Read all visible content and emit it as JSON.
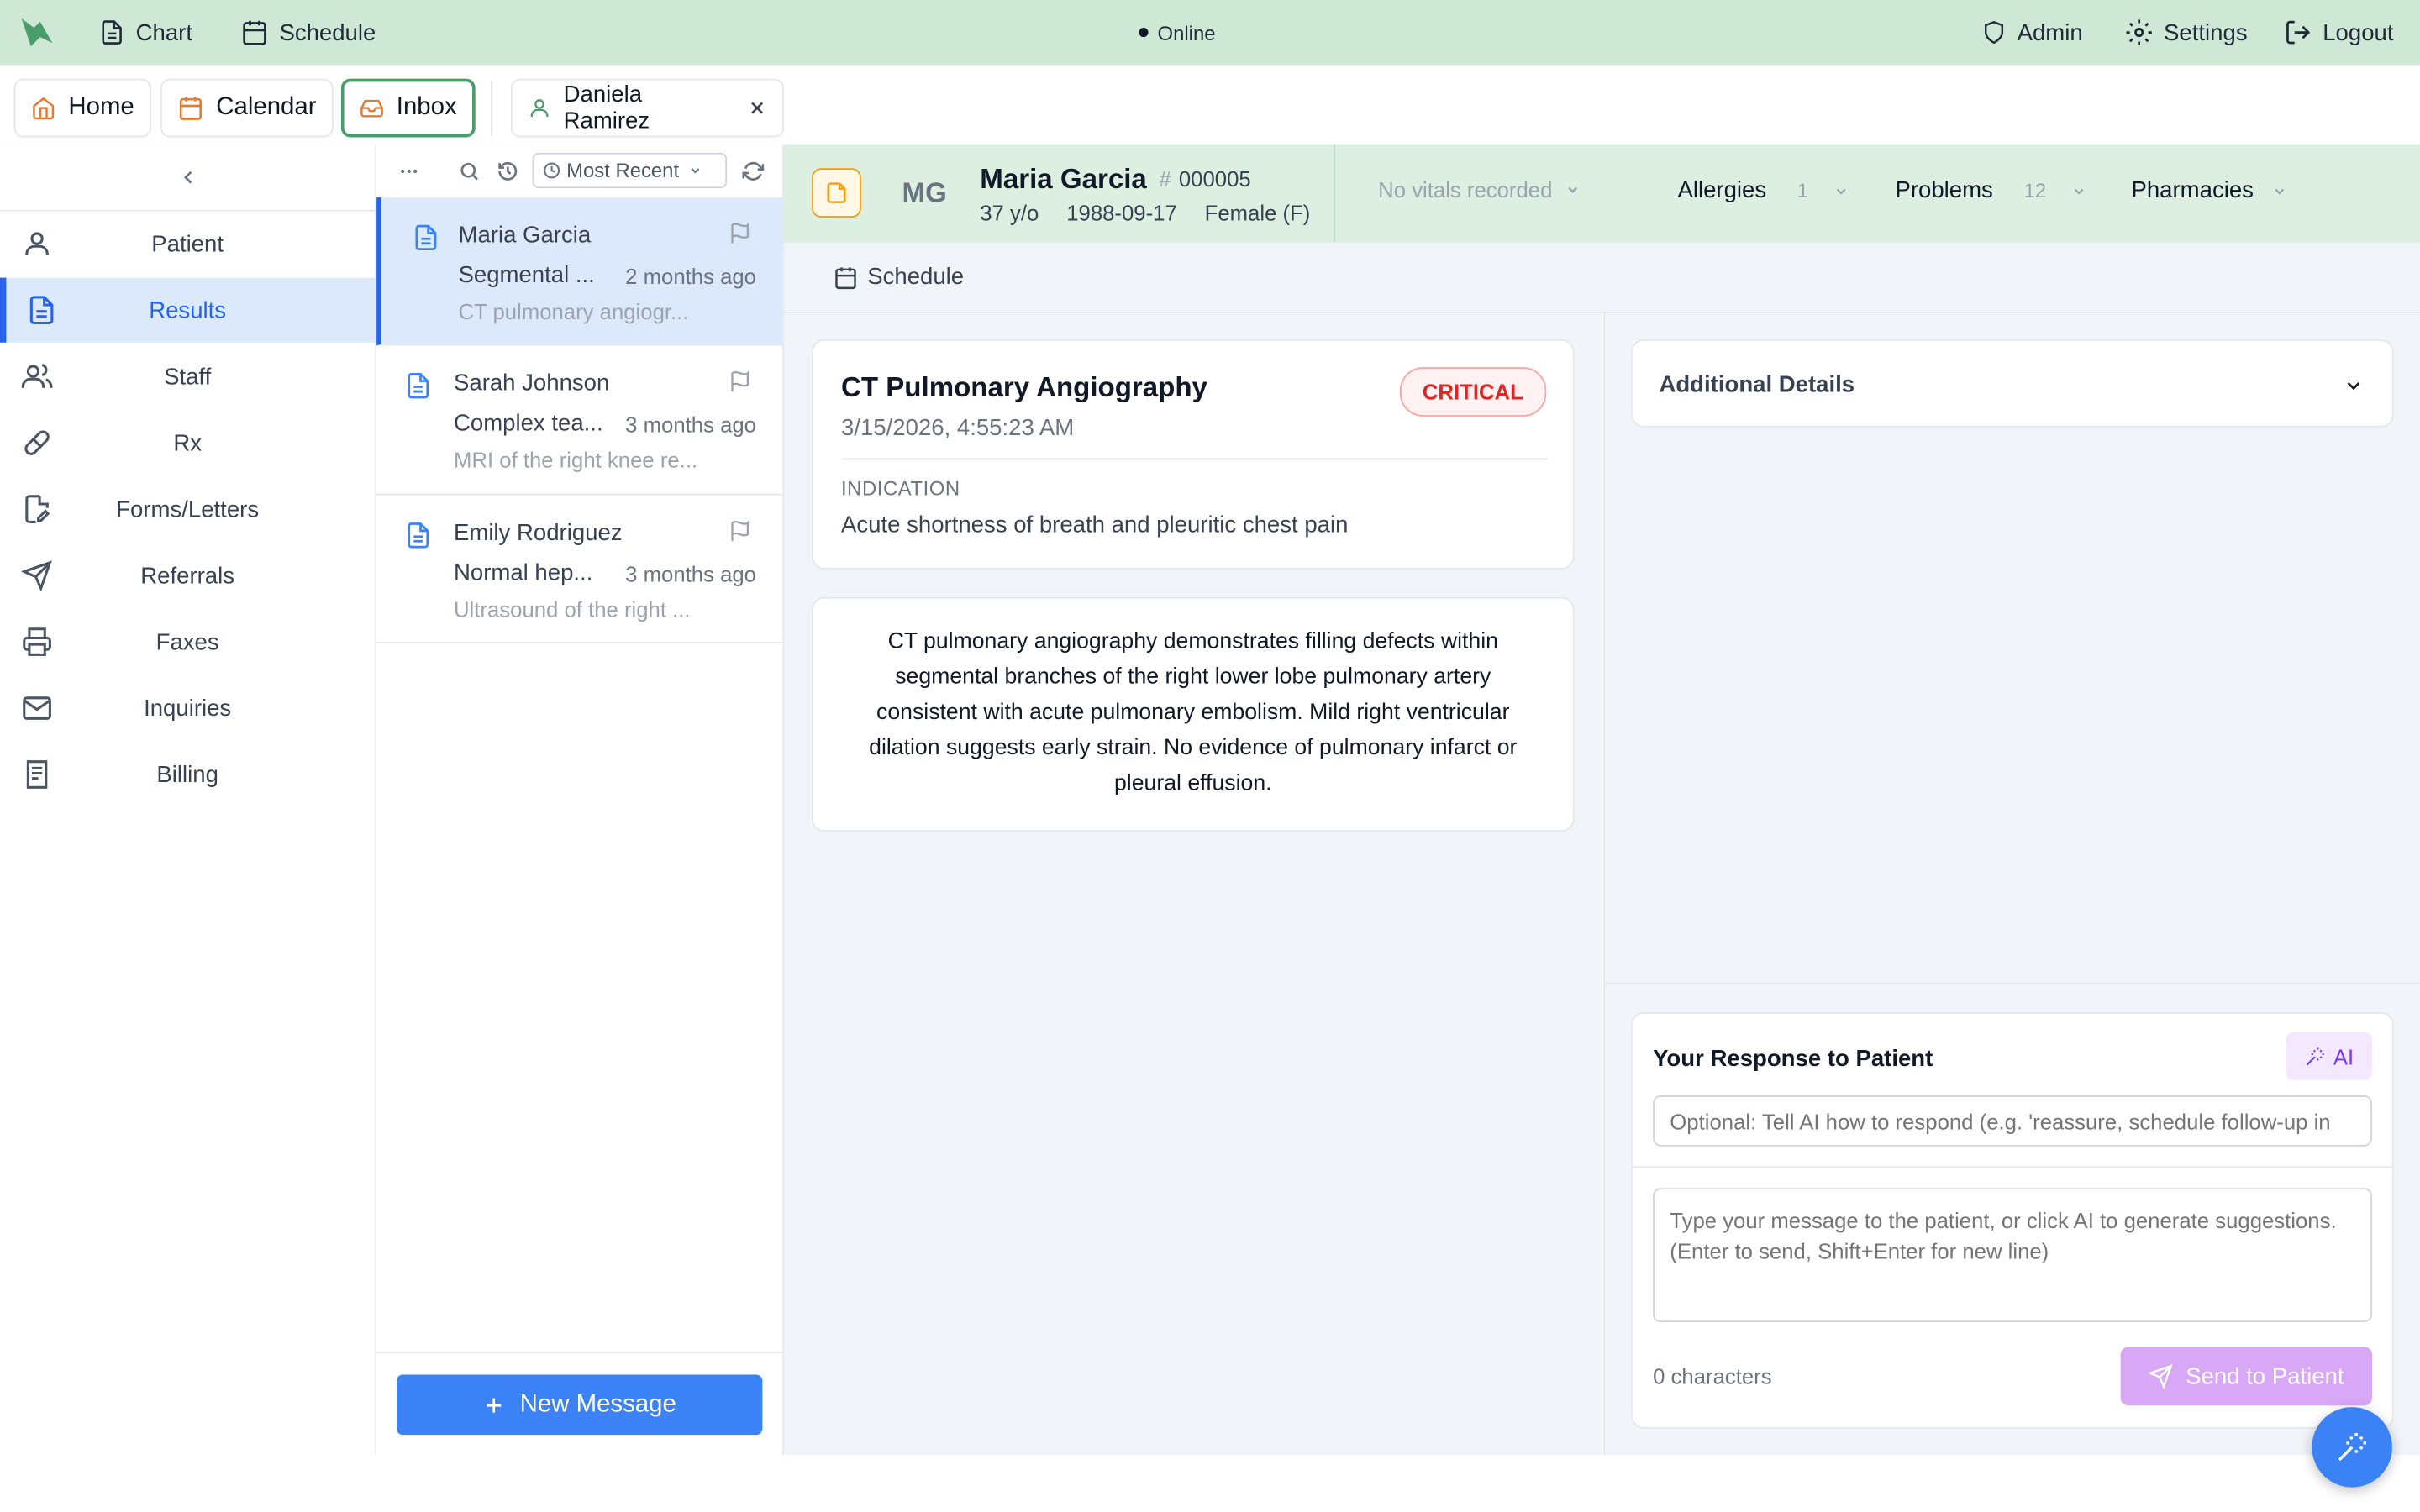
{
  "topnav": {
    "chart_label": "Chart",
    "schedule_label": "Schedule",
    "status": "Online",
    "admin_label": "Admin",
    "settings_label": "Settings",
    "logout_label": "Logout"
  },
  "tabs": [
    {
      "label": "Home"
    },
    {
      "label": "Calendar"
    },
    {
      "label": "Inbox"
    },
    {
      "label": "Daniela Ramirez"
    }
  ],
  "sidebar": {
    "items": [
      {
        "label": "Patient",
        "icon": "user-icon"
      },
      {
        "label": "Results",
        "icon": "document-icon"
      },
      {
        "label": "Staff",
        "icon": "users-icon"
      },
      {
        "label": "Rx",
        "icon": "pill-icon"
      },
      {
        "label": "Forms/Letters",
        "icon": "file-edit-icon"
      },
      {
        "label": "Referrals",
        "icon": "send-icon"
      },
      {
        "label": "Faxes",
        "icon": "printer-icon"
      },
      {
        "label": "Inquiries",
        "icon": "mail-icon"
      },
      {
        "label": "Billing",
        "icon": "receipt-icon"
      }
    ]
  },
  "inbox": {
    "sort_label": "Most Recent",
    "new_message_label": "New Message",
    "messages": [
      {
        "name": "Maria Garcia",
        "subject": "Segmental ...",
        "time": "2 months ago",
        "preview": "CT pulmonary angiogr..."
      },
      {
        "name": "Sarah Johnson",
        "subject": "Complex tea...",
        "time": "3 months ago",
        "preview": "MRI of the right knee re..."
      },
      {
        "name": "Emily Rodriguez",
        "subject": "Normal hep...",
        "time": "3 months ago",
        "preview": "Ultrasound of the right ..."
      }
    ]
  },
  "patient": {
    "initials": "MG",
    "name": "Maria Garcia",
    "id_prefix": "#",
    "id": "000005",
    "age": "37 y/o",
    "dob": "1988-09-17",
    "sex": "Female (F)",
    "vitals": "No vitals recorded",
    "allergies_label": "Allergies",
    "allergies_count": "1",
    "problems_label": "Problems",
    "problems_count": "12",
    "pharmacies_label": "Pharmacies"
  },
  "subnav": {
    "schedule_label": "Schedule"
  },
  "result": {
    "title": "CT Pulmonary Angiography",
    "datetime": "3/15/2026, 4:55:23 AM",
    "status": "CRITICAL",
    "indication_label": "INDICATION",
    "indication": "Acute shortness of breath and pleuritic chest pain",
    "report": "CT pulmonary angiography demonstrates filling defects within segmental branches of the right lower lobe pulmonary artery consistent with acute pulmonary embolism. Mild right ventricular dilation suggests early strain. No evidence of pulmonary infarct or pleural effusion."
  },
  "details": {
    "title": "Additional Details"
  },
  "response": {
    "title": "Your Response to Patient",
    "ai_label": "AI",
    "ai_prompt_placeholder": "Optional: Tell AI how to respond (e.g. 'reassure, schedule follow-up in",
    "message_placeholder": "Type your message to the patient, or click AI to generate suggestions. (Enter to send, Shift+Enter for new line)",
    "char_count": "0 characters",
    "send_label": "Send to Patient"
  },
  "colors": {
    "topbar": "#cfe8d5",
    "accent_blue": "#3b82f6",
    "critical_red": "#dc2626",
    "ai_purple": "#7c3aed"
  }
}
